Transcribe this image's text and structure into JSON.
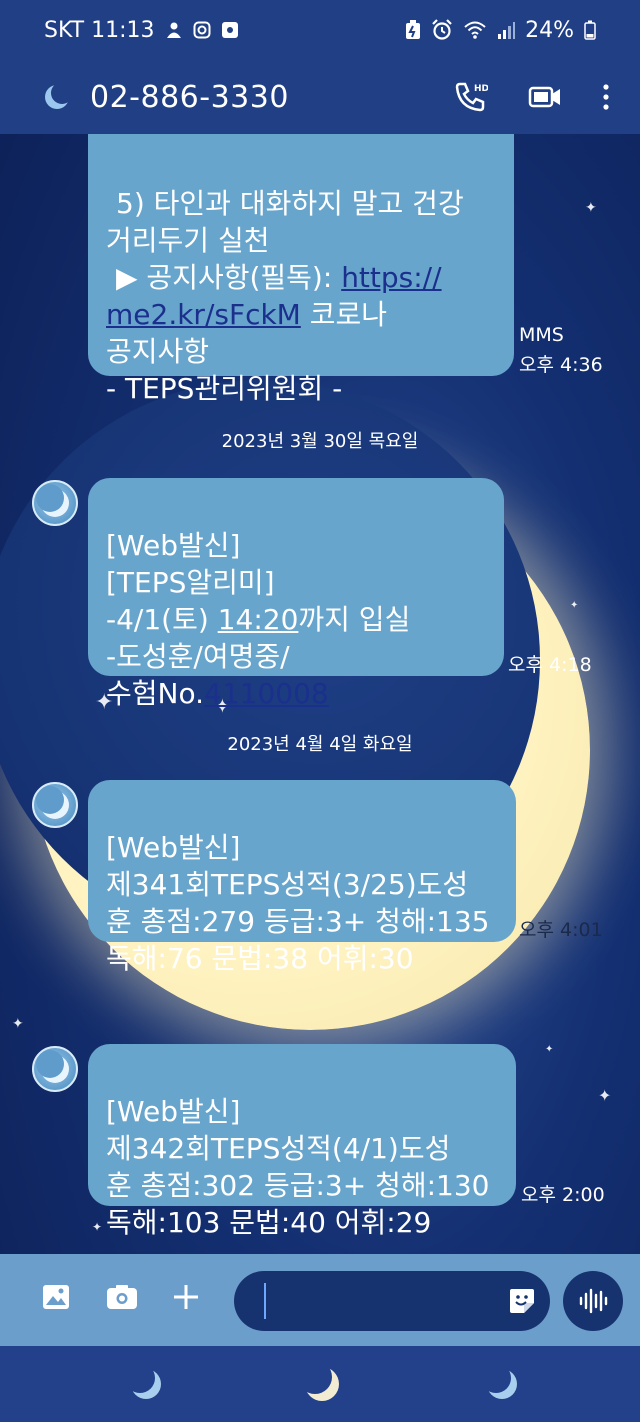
{
  "status_bar": {
    "carrier_time": "SKT 11:13",
    "battery": "24%"
  },
  "header": {
    "phone_number": "02-886-3330"
  },
  "messages": [
    {
      "line1": "5) 타인과 대화하지 말고 건강",
      "line2": "거리두기 실천",
      "line3_prefix": "▶ 공지사항(필독): ",
      "line3_link": "https://",
      "line4_link": "me2.kr/sFckM",
      "line4_suffix": " 코로나",
      "line5": "공지사항",
      "line6": " - TEPS관리위원회 -",
      "type": "MMS",
      "time": "오후 4:36"
    },
    {
      "line1": "[Web발신]",
      "line2": "[TEPS알리미]",
      "line3_prefix": "-4/1(토) ",
      "line3_link": "14:20",
      "line3_suffix": "까지 입실",
      "line4": "-도성훈/여명중/",
      "line5_prefix": "수험No.",
      "line5_link": "4110008",
      "time": "오후 4:18"
    },
    {
      "line1": "[Web발신]",
      "line2": "제341회TEPS성적(3/25)도성",
      "line3": "훈 총점:279 등급:3+ 청해:135",
      "line4": "독해:76 문법:38 어휘:30",
      "time": "오후 4:01"
    },
    {
      "line1": "[Web발신]",
      "line2": "제342회TEPS성적(4/1)도성",
      "line3": "훈 총점:302 등급:3+ 청해:130",
      "line4": "독해:103 문법:40 어휘:29",
      "time": "오후 2:00"
    }
  ],
  "dates": [
    "2023년 3월 30일 목요일",
    "2023년 4월 4일 화요일"
  ],
  "composer": {
    "placeholder": ""
  },
  "icons": {
    "status": [
      "person-icon",
      "instagram-icon",
      "app-icon",
      "battery-saver-icon",
      "alarm-icon",
      "wifi-icon",
      "signal-icon",
      "battery-icon"
    ],
    "header": [
      "moon-avatar-icon",
      "call-hd-icon",
      "video-call-icon",
      "more-icon"
    ],
    "composer": [
      "gallery-icon",
      "camera-icon",
      "plus-icon",
      "sticker-icon",
      "voice-icon"
    ],
    "nav": [
      "moon-nav-icon"
    ]
  },
  "colors": {
    "bubble": "#68a5cc",
    "link": "#1b2f8d",
    "bar": "#213f84"
  }
}
